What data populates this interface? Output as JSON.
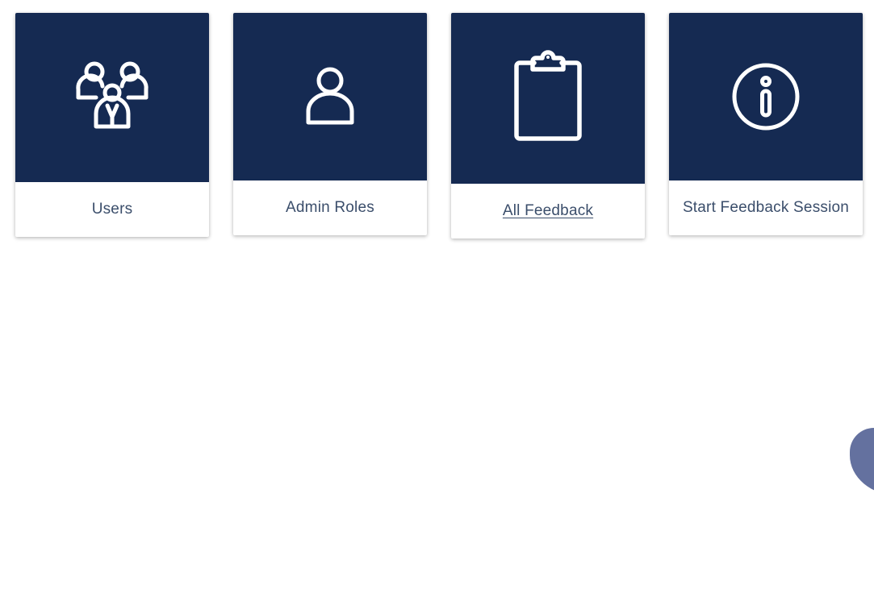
{
  "cards": [
    {
      "label": "Users",
      "icon": "users-group-icon"
    },
    {
      "label": "Admin Roles",
      "icon": "person-icon"
    },
    {
      "label": "All Feedback",
      "icon": "clipboard-icon"
    },
    {
      "label": "Start Feedback Session",
      "icon": "info-icon"
    }
  ],
  "colors": {
    "card_header_bg": "#152a52",
    "label_text": "#3b4e6b",
    "floating_shape": "#64719f",
    "icon_stroke": "#ffffff"
  }
}
